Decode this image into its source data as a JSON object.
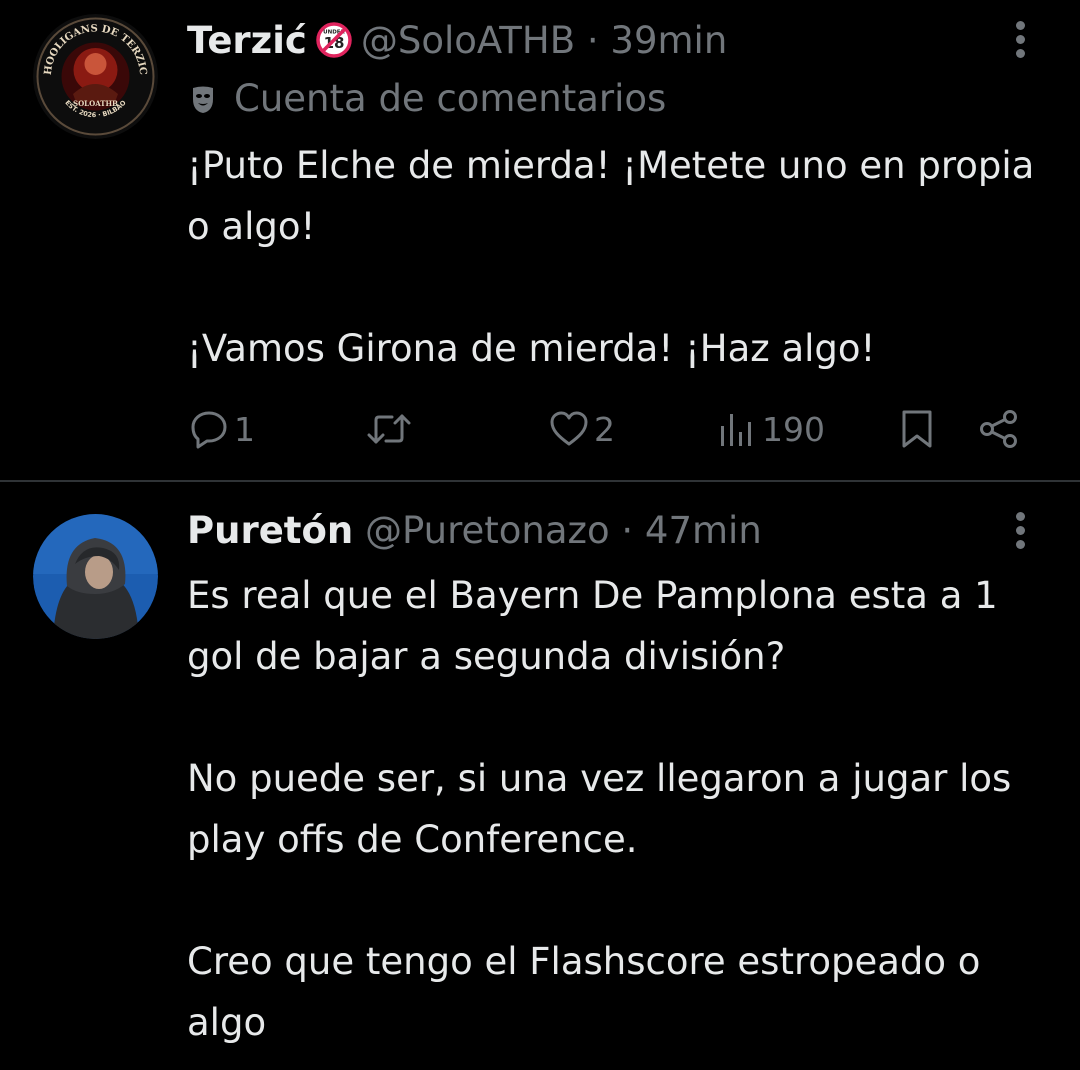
{
  "tweets": [
    {
      "name": "Terzić",
      "badge_text": "18",
      "badge_small_text": "UNDER",
      "handle": "@SoloATHB",
      "separator": "·",
      "time": "39min",
      "parody_label": "Cuenta de comentarios",
      "avatar_text_top": "HOOLIGANS DE TERZIC",
      "avatar_text_mid": "SOLOATHB",
      "avatar_text_bottom": "EST. 2026 · BILBAO",
      "paragraphs": [
        "¡Puto Elche de mierda! ¡Metete uno en propia o algo!",
        "¡Vamos Girona de mierda! ¡Haz algo!"
      ],
      "stats": {
        "replies": "1",
        "likes": "2",
        "views": "190"
      }
    },
    {
      "name": "Puretón",
      "handle": "@Puretonazo",
      "separator": "·",
      "time": "47min",
      "paragraphs": [
        "Es real que el Bayern De Pamplona esta a 1 gol de bajar a segunda división?",
        "No puede ser, si una vez llegaron a jugar los play offs de Conference.",
        "Creo que tengo el Flashscore estropeado o algo"
      ]
    }
  ],
  "icons": {
    "more": "more-vertical-icon",
    "parody": "theater-mask-icon",
    "reply": "reply-icon",
    "retweet": "retweet-icon",
    "like": "heart-icon",
    "views": "views-icon",
    "bookmark": "bookmark-icon",
    "share": "share-icon"
  },
  "colors": {
    "background": "#000000",
    "primary_text": "#e7e9ea",
    "secondary_text": "#71767b",
    "divider": "#2f3336",
    "badge_red": "#e0245e"
  }
}
